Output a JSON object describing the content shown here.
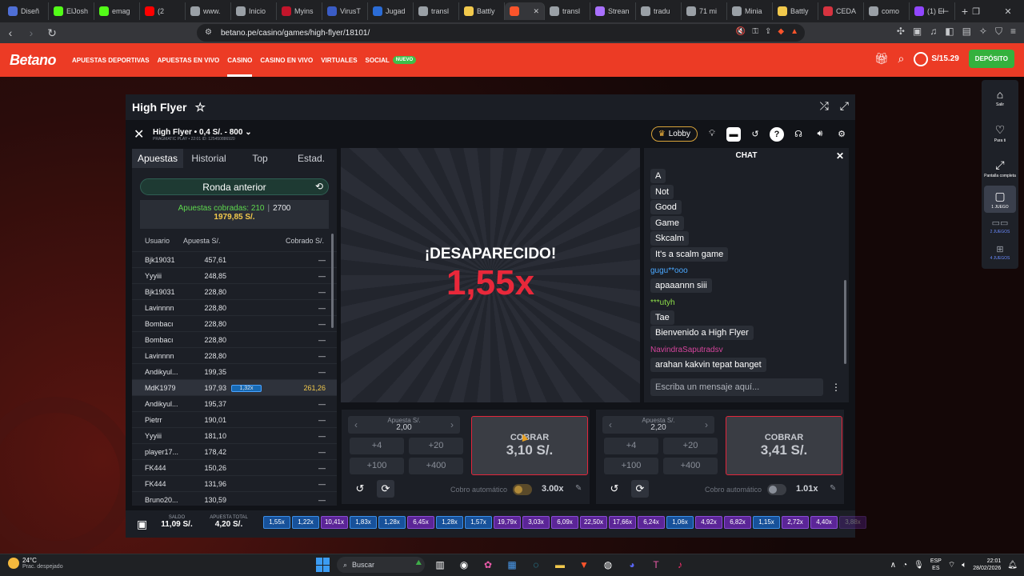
{
  "browser": {
    "tabs": [
      {
        "label": "Diseñ",
        "color": "#4f6fd6"
      },
      {
        "label": "ElJosh",
        "color": "#53fc18"
      },
      {
        "label": "emag",
        "color": "#53fc18"
      },
      {
        "label": "(2",
        "color": "#ff0000"
      },
      {
        "label": "www.",
        "color": "#9aa0a6"
      },
      {
        "label": "Inicio",
        "color": "#9aa0a6"
      },
      {
        "label": "Myins",
        "color": "#c2152b"
      },
      {
        "label": "VirusT",
        "color": "#3a5cc5"
      },
      {
        "label": "Jugad",
        "color": "#2b6cd6"
      },
      {
        "label": "transl",
        "color": "#9aa0a6"
      },
      {
        "label": "Battly",
        "color": "#f2c94c"
      },
      {
        "label": "",
        "color": "#fb542b",
        "active": true
      },
      {
        "label": "transl",
        "color": "#9aa0a6"
      },
      {
        "label": "Strean",
        "color": "#a970ff"
      },
      {
        "label": "tradu",
        "color": "#9aa0a6"
      },
      {
        "label": "71 mi",
        "color": "#9aa0a6"
      },
      {
        "label": "Minia",
        "color": "#9aa0a6"
      },
      {
        "label": "Battly",
        "color": "#f2c94c"
      },
      {
        "label": "CEDA",
        "color": "#d6333f"
      },
      {
        "label": "como",
        "color": "#9aa0a6"
      },
      {
        "label": "(1) El",
        "color": "#9146ff"
      }
    ],
    "url": "betano.pe/casino/games/high-flyer/18101/"
  },
  "site": {
    "logo": "Betano",
    "nav": [
      {
        "label": "APUESTAS DEPORTIVAS"
      },
      {
        "label": "APUESTAS EN VIVO"
      },
      {
        "label": "CASINO",
        "active": true
      },
      {
        "label": "CASINO EN VIVO"
      },
      {
        "label": "VIRTUALES"
      },
      {
        "label": "SOCIAL"
      }
    ],
    "new_badge": "NUEVO",
    "balance": "S/15.29",
    "deposit": "DEPÓSITO"
  },
  "rail": [
    {
      "label": "Salir",
      "icon": "home-icon",
      "glyph": "⌂"
    },
    {
      "label": "Para ti",
      "icon": "heart-icon",
      "glyph": "♡"
    },
    {
      "label": "Pantalla completa",
      "icon": "fullscreen-icon",
      "glyph": "⤢"
    },
    {
      "label": "1 JUEGO",
      "icon": "single-game-icon",
      "glyph": "▢"
    },
    {
      "label": "2 JUEGOS",
      "icon": "two-games-icon",
      "glyph": "▭▭"
    },
    {
      "label": "4 JUEGOS",
      "icon": "four-games-icon",
      "glyph": "⊞"
    }
  ],
  "game": {
    "title": "High Flyer",
    "info": "High Flyer • 0,4 S/. - 800",
    "provider": "PRAGMATIC PLAY • 22:01 ID: 125450886920",
    "lobby": "Lobby",
    "tabs": [
      "Apuestas",
      "Historial",
      "Top",
      "Estad."
    ],
    "prev_round": "Ronda anterior",
    "stats": {
      "label": "Apuestas cobradas:",
      "cashed": "210",
      "total": "2700",
      "amount": "1979,85 S/."
    },
    "table_headers": {
      "user": "Usuario",
      "bet": "Apuesta S/.",
      "cashout": "Cobrado S/."
    },
    "rows": [
      {
        "user": "Bjk19031",
        "bet": "457,61",
        "mult": "",
        "cash": "—"
      },
      {
        "user": "Yyyiii",
        "bet": "248,85",
        "mult": "",
        "cash": "—"
      },
      {
        "user": "Bjk19031",
        "bet": "228,80",
        "mult": "",
        "cash": "—"
      },
      {
        "user": "Lavinnnn",
        "bet": "228,80",
        "mult": "",
        "cash": "—"
      },
      {
        "user": "Bombacı",
        "bet": "228,80",
        "mult": "",
        "cash": "—"
      },
      {
        "user": "Bombacı",
        "bet": "228,80",
        "mult": "",
        "cash": "—"
      },
      {
        "user": "Lavinnnn",
        "bet": "228,80",
        "mult": "",
        "cash": "—"
      },
      {
        "user": "Andikyul...",
        "bet": "199,35",
        "mult": "",
        "cash": "—"
      },
      {
        "user": "MdK1979",
        "bet": "197,93",
        "mult": "1,32x",
        "cash": "261,26",
        "highlight": true
      },
      {
        "user": "Andikyul...",
        "bet": "195,37",
        "mult": "",
        "cash": "—"
      },
      {
        "user": "Pietrr",
        "bet": "190,01",
        "mult": "",
        "cash": "—"
      },
      {
        "user": "Yyyiii",
        "bet": "181,10",
        "mult": "",
        "cash": "—"
      },
      {
        "user": "player17...",
        "bet": "178,42",
        "mult": "",
        "cash": "—"
      },
      {
        "user": "FK444",
        "bet": "150,26",
        "mult": "",
        "cash": "—"
      },
      {
        "user": "FK444",
        "bet": "131,96",
        "mult": "",
        "cash": "—"
      },
      {
        "user": "Bruno20...",
        "bet": "130,59",
        "mult": "",
        "cash": "—"
      }
    ],
    "stage_title": "¡DESAPARECIDO!",
    "stage_mult": "1,55x",
    "chat": {
      "title": "CHAT",
      "messages": [
        {
          "name": "",
          "text": "A"
        },
        {
          "name": "",
          "text": "Not"
        },
        {
          "name": "",
          "text": "Good"
        },
        {
          "name": "",
          "text": "Game"
        },
        {
          "name": "",
          "text": "Skcalm"
        },
        {
          "name": "",
          "text": "It's a scalm game"
        },
        {
          "name": "gugu**ooo",
          "name_color": "#4aa8ff",
          "text": "apaaannn siii"
        },
        {
          "name": "***utyh",
          "name_color": "#8fe04a",
          "text": "Tae"
        },
        {
          "name": "",
          "text": "Bienvenido a High Flyer"
        },
        {
          "name": "NavindraSaputradsv",
          "name_color": "#d4459c",
          "text": "arahan kakvin tepat banget"
        }
      ],
      "placeholder": "Escriba un mensaje aquí..."
    },
    "bets": [
      {
        "label": "Apuesta S/.",
        "amount": "2,00",
        "quick": [
          "+4",
          "+20",
          "+100",
          "+400"
        ],
        "cash_label": "COBRAR",
        "cash_value": "3,10 S/.",
        "auto_label": "Cobro automático",
        "auto_value": "3.00x",
        "auto_on": true
      },
      {
        "label": "Apuesta S/.",
        "amount": "2,20",
        "quick": [
          "+4",
          "+20",
          "+100",
          "+400"
        ],
        "cash_label": "COBRAR",
        "cash_value": "3,41 S/.",
        "auto_label": "Cobro automático",
        "auto_value": "1.01x",
        "auto_on": false
      }
    ],
    "footer": {
      "balance_label": "SALDO",
      "balance": "11,09 S/.",
      "total_label": "APUESTA TOTAL",
      "total": "4,20 S/.",
      "multipliers": [
        {
          "v": "1,55x",
          "c": "blue"
        },
        {
          "v": "1,22x",
          "c": "blue"
        },
        {
          "v": "10,41x",
          "c": "purple"
        },
        {
          "v": "1,83x",
          "c": "blue"
        },
        {
          "v": "1,28x",
          "c": "blue"
        },
        {
          "v": "6,45x",
          "c": "purple"
        },
        {
          "v": "1,28x",
          "c": "blue"
        },
        {
          "v": "1,57x",
          "c": "blue"
        },
        {
          "v": "19,79x",
          "c": "purple"
        },
        {
          "v": "3,03x",
          "c": "purple"
        },
        {
          "v": "6,09x",
          "c": "purple"
        },
        {
          "v": "22,50x",
          "c": "purple"
        },
        {
          "v": "17,66x",
          "c": "purple"
        },
        {
          "v": "6,24x",
          "c": "purple"
        },
        {
          "v": "1,06x",
          "c": "blue"
        },
        {
          "v": "4,92x",
          "c": "purple"
        },
        {
          "v": "6,82x",
          "c": "purple"
        },
        {
          "v": "1,15x",
          "c": "blue"
        },
        {
          "v": "2,72x",
          "c": "purple"
        },
        {
          "v": "4,40x",
          "c": "purple"
        },
        {
          "v": "3,88x",
          "c": "purple",
          "fade": true
        }
      ]
    }
  },
  "taskbar": {
    "temp": "24°C",
    "weather": "Prac. despejado",
    "search": "Buscar",
    "lang1": "ESP",
    "lang2": "ES",
    "time": "22:01",
    "date": "28/02/2026"
  }
}
